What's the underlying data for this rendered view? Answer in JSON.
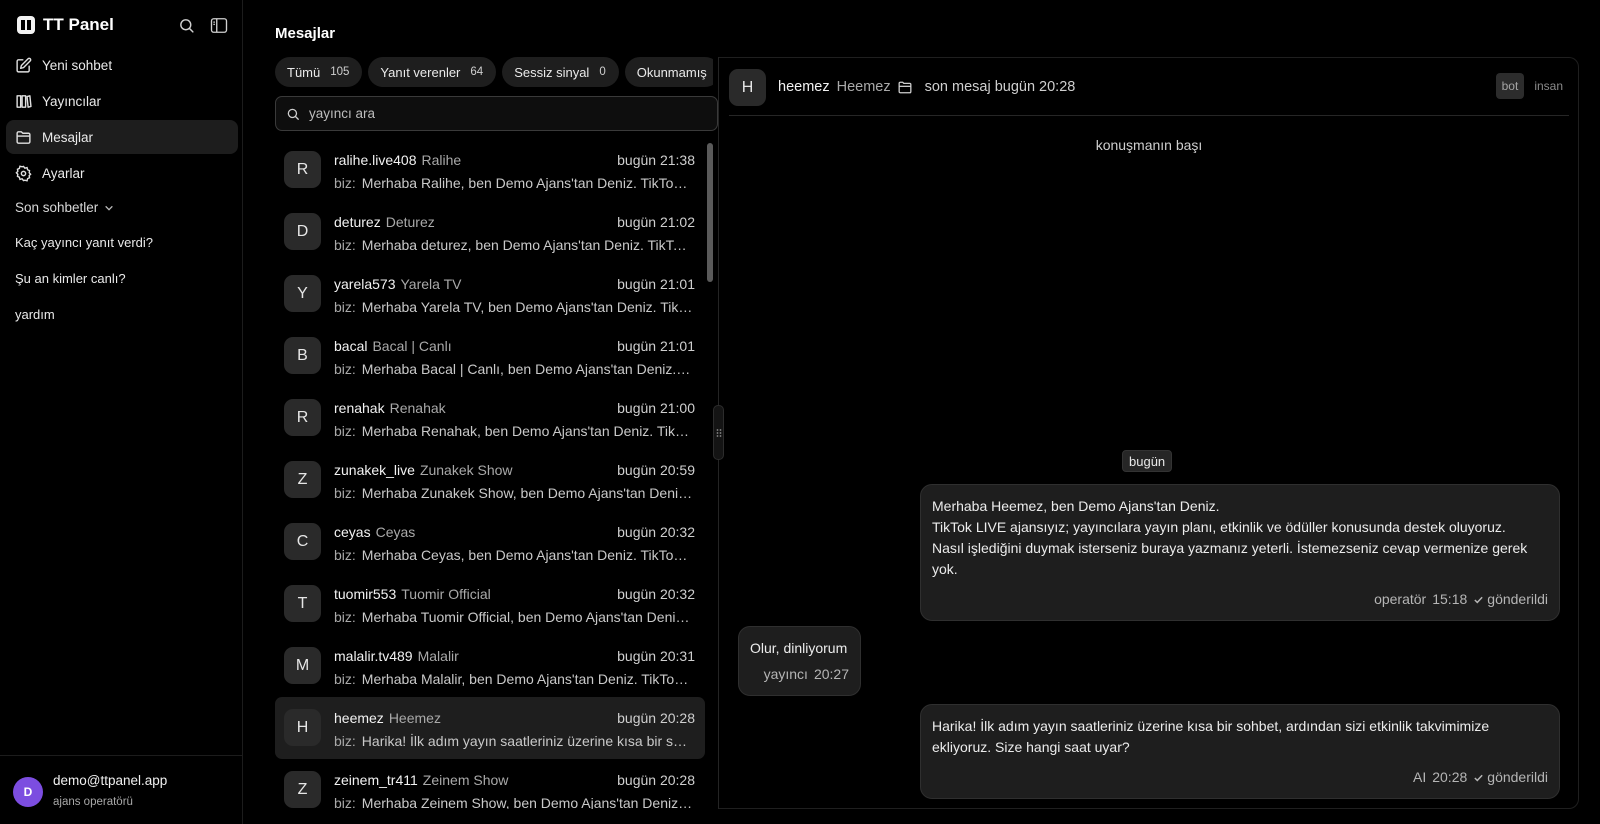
{
  "app": {
    "name": "TT Panel"
  },
  "sidebar": {
    "nav": [
      {
        "label": "Yeni sohbet",
        "icon": "edit-icon"
      },
      {
        "label": "Yayıncılar",
        "icon": "columns-icon"
      },
      {
        "label": "Mesajlar",
        "icon": "folder-icon",
        "active": true
      },
      {
        "label": "Ayarlar",
        "icon": "gear-icon"
      }
    ],
    "recent_header": "Son sohbetler",
    "recent": [
      "Kaç yayıncı yanıt verdi?",
      "Şu an kimler canlı?",
      "yardım"
    ],
    "user": {
      "initial": "D",
      "email": "demo@ttpanel.app",
      "role": "ajans operatörü"
    }
  },
  "messages_page": {
    "title": "Mesajlar",
    "filters": [
      {
        "label": "Tümü",
        "count": "105"
      },
      {
        "label": "Yanıt verenler",
        "count": "64"
      },
      {
        "label": "Sessiz sinyal",
        "count": "0"
      },
      {
        "label": "Okunmamış",
        "count": ""
      }
    ],
    "search_placeholder": "yayıncı ara",
    "list": [
      {
        "initial": "R",
        "handle": "ralihe.live408",
        "name": "Ralihe",
        "time": "bugün 21:38",
        "prefix": "biz:",
        "preview": "Merhaba Ralihe, ben Demo Ajans'tan Deniz. TikTok LIVE ajansıyız; yayıncılara yayın planı, etkinlik ve ödüller konusunda destek oluyoruz."
      },
      {
        "initial": "D",
        "handle": "deturez",
        "name": "Deturez",
        "time": "bugün 21:02",
        "prefix": "biz:",
        "preview": "Merhaba deturez, ben Demo Ajans'tan Deniz. TikTok LIVE ajansıyız; yayıncılara yayın planı, etkinlik ve ödüller konusunda destek oluyoruz."
      },
      {
        "initial": "Y",
        "handle": "yarela573",
        "name": "Yarela TV",
        "time": "bugün 21:01",
        "prefix": "biz:",
        "preview": "Merhaba Yarela TV, ben Demo Ajans'tan Deniz. TikTok LIVE ajansıyız; yayıncılara yayın planı, etkinlik ve ödüller konusunda destek oluyoruz."
      },
      {
        "initial": "B",
        "handle": "bacal",
        "name": "Bacal | Canlı",
        "time": "bugün 21:01",
        "prefix": "biz:",
        "preview": "Merhaba Bacal | Canlı, ben Demo Ajans'tan Deniz. TikTok LIVE ajansıyız; yayıncılara yayın planı, etkinlik ve ödüller konusunda destek oluyoruz."
      },
      {
        "initial": "R",
        "handle": "renahak",
        "name": "Renahak",
        "time": "bugün 21:00",
        "prefix": "biz:",
        "preview": "Merhaba Renahak, ben Demo Ajans'tan Deniz. TikTok LIVE ajansıyız; yayıncılara yayın planı, etkinlik ve ödüller konusunda destek oluyoruz."
      },
      {
        "initial": "Z",
        "handle": "zunakek_live",
        "name": "Zunakek Show",
        "time": "bugün 20:59",
        "prefix": "biz:",
        "preview": "Merhaba Zunakek Show, ben Demo Ajans'tan Deniz. TikTok LIVE ajansıyız; yayıncılara yayın planı, etkinlik ve ödüller konusunda destek oluyoruz."
      },
      {
        "initial": "C",
        "handle": "ceyas",
        "name": "Ceyas",
        "time": "bugün 20:32",
        "prefix": "biz:",
        "preview": "Merhaba Ceyas, ben Demo Ajans'tan Deniz. TikTok LIVE ajansıyız; yayıncılara yayın planı, etkinlik ve ödüller konusunda destek oluyoruz."
      },
      {
        "initial": "T",
        "handle": "tuomir553",
        "name": "Tuomir Official",
        "time": "bugün 20:32",
        "prefix": "biz:",
        "preview": "Merhaba Tuomir Official, ben Demo Ajans'tan Deniz. TikTok LIVE ajansıyız; yayıncılara yayın planı, etkinlik ve ödüller konusunda destek oluyoruz."
      },
      {
        "initial": "M",
        "handle": "malalir.tv489",
        "name": "Malalir",
        "time": "bugün 20:31",
        "prefix": "biz:",
        "preview": "Merhaba Malalir, ben Demo Ajans'tan Deniz. TikTok LIVE ajansıyız; yayıncılara yayın planı, etkinlik ve ödüller konusunda destek oluyoruz."
      },
      {
        "initial": "H",
        "handle": "heemez",
        "name": "Heemez",
        "time": "bugün 20:28",
        "prefix": "biz:",
        "preview": "Harika! İlk adım yayın saatleriniz üzerine kısa bir sohbet, ardından sizi etkinlik takvimimize ekliyoruz. Size hangi saat uyar?",
        "selected": true
      },
      {
        "initial": "Z",
        "handle": "zeinem_tr411",
        "name": "Zeinem Show",
        "time": "bugün 20:28",
        "prefix": "biz:",
        "preview": "Merhaba Zeinem Show, ben Demo Ajans'tan Deniz. TikTok LIVE ajansıyız; yayıncılara yayın planı, etkinlik ve ödüller konusunda destek oluyoruz."
      }
    ]
  },
  "chat": {
    "initial": "H",
    "handle": "heemez",
    "name": "Heemez",
    "last_message": "son mesaj bugün 20:28",
    "modes": [
      {
        "label": "bot",
        "active": true
      },
      {
        "label": "insan",
        "active": false
      }
    ],
    "conversation_start": "konuşmanın başı",
    "day_label": "bugün",
    "messages": [
      {
        "side": "out",
        "lines": [
          "Merhaba Heemez, ben Demo Ajans'tan Deniz.",
          "TikTok LIVE ajansıyız; yayıncılara yayın planı, etkinlik ve ödüller konusunda destek oluyoruz.",
          "Nasıl işlediğini duymak isterseniz buraya yazmanız yeterli. İstemezseniz cevap vermenize gerek yok."
        ],
        "sender": "operatör",
        "time": "15:18",
        "status": "gönderildi"
      },
      {
        "side": "in",
        "lines": [
          "Olur, dinliyorum"
        ],
        "sender": "yayıncı",
        "time": "20:27",
        "status": ""
      },
      {
        "side": "out",
        "lines": [
          "Harika! İlk adım yayın saatleriniz üzerine kısa bir sohbet, ardından sizi etkinlik takvimimize ekliyoruz. Size hangi saat uyar?"
        ],
        "sender": "AI",
        "time": "20:28",
        "status": "gönderildi"
      }
    ]
  }
}
